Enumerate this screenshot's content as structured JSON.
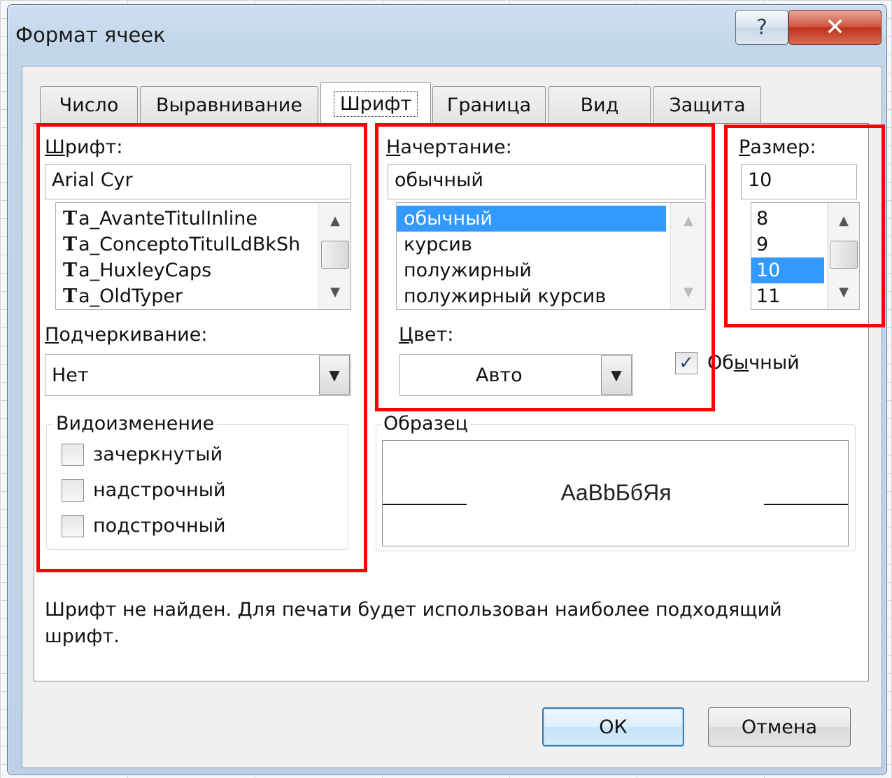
{
  "dialog": {
    "title": "Формат ячеек",
    "help_label": "?",
    "close_label": "✕"
  },
  "tabs": [
    {
      "label": "Число"
    },
    {
      "label": "Выравнивание"
    },
    {
      "label": "Шрифт"
    },
    {
      "label": "Граница"
    },
    {
      "label": "Вид"
    },
    {
      "label": "Защита"
    }
  ],
  "font": {
    "label": "Шрифт:",
    "value": "Arial Cyr",
    "items": [
      "a_AvanteTitulInline",
      "a_ConceptoTitulLdBkSh",
      "a_HuxleyCaps",
      "a_OldTyper"
    ],
    "item_icon": "truetype-icon",
    "scroll_position": 0.4
  },
  "style": {
    "label": "Начертание:",
    "value": "обычный",
    "items": [
      "обычный",
      "курсив",
      "полужирный",
      "полужирный курсив"
    ],
    "selected": "обычный"
  },
  "size": {
    "label": "Размер:",
    "value": "10",
    "items": [
      "8",
      "9",
      "10",
      "11"
    ],
    "selected": "10"
  },
  "underline": {
    "label": "Подчеркивание:",
    "value": "Нет"
  },
  "color": {
    "label": "Цвет:",
    "value": "Авто"
  },
  "normal_font": {
    "label": "Обычный",
    "checked": true
  },
  "effects": {
    "title": "Видоизменение",
    "items": [
      {
        "label": "зачеркнутый",
        "checked": false
      },
      {
        "label": "надстрочный",
        "checked": false
      },
      {
        "label": "подстрочный",
        "checked": false
      }
    ]
  },
  "preview": {
    "title": "Образец",
    "text": "AaBbБбЯя"
  },
  "message": "Шрифт не найден. Для печати будет использован наиболее подходящий шрифт.",
  "buttons": {
    "ok": "ОК",
    "cancel": "Отмена"
  },
  "colors": {
    "highlight": "#ff0000",
    "selection": "#3399ff"
  }
}
